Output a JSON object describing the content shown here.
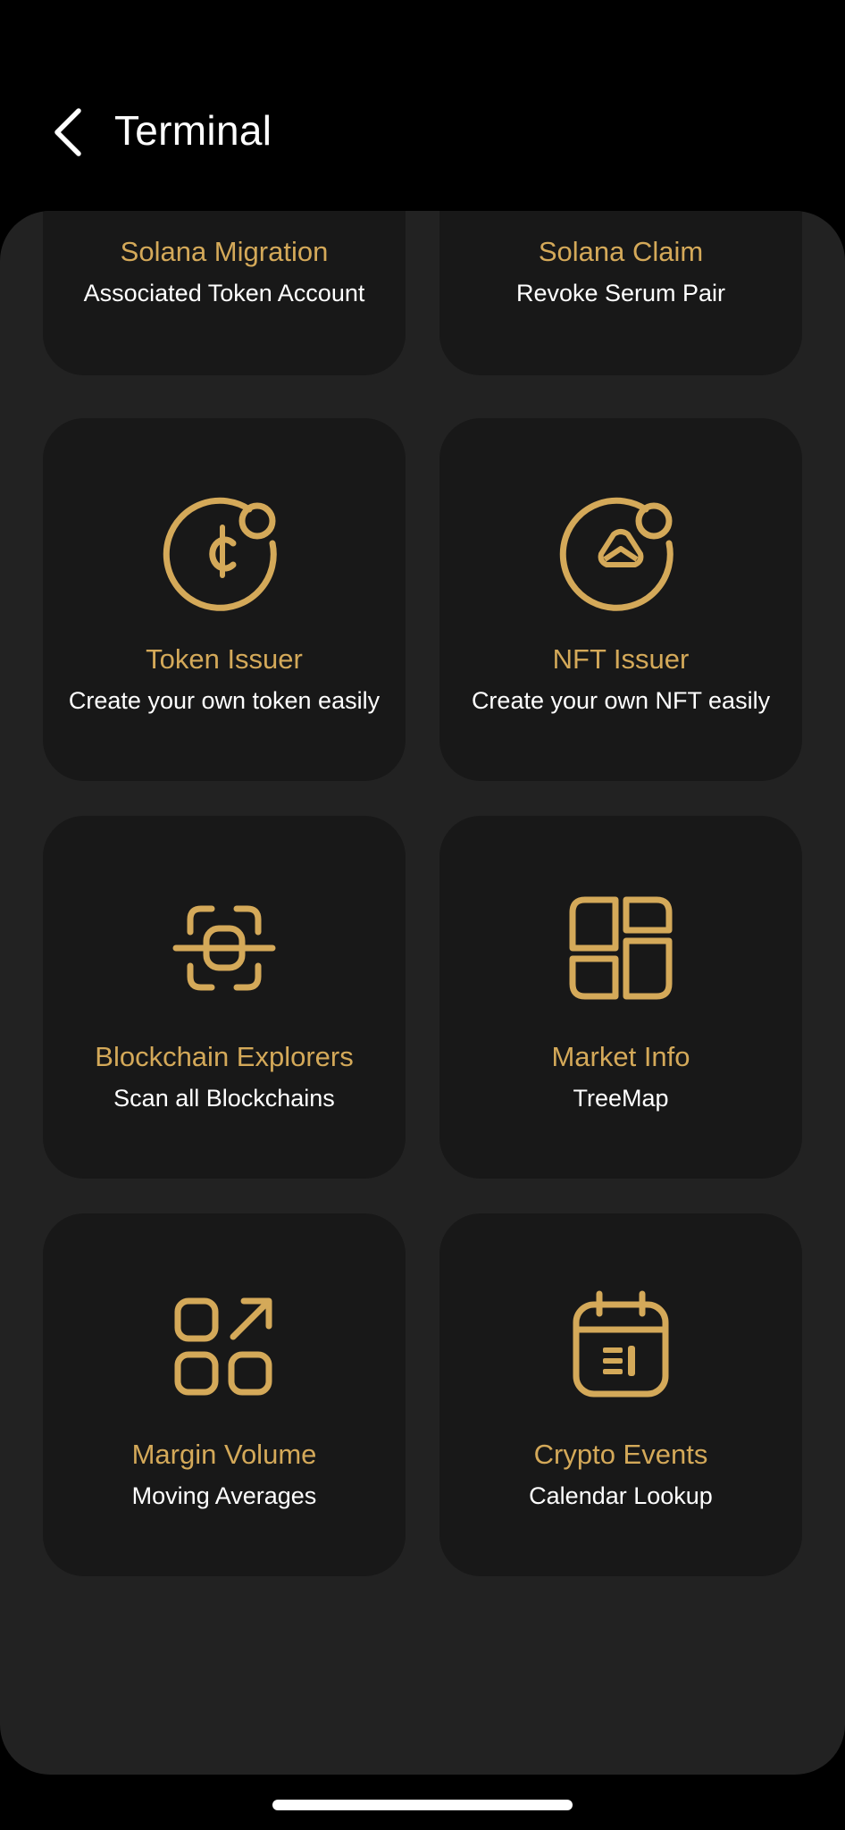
{
  "header": {
    "title": "Terminal",
    "back_icon": "chevron-left-icon"
  },
  "colors": {
    "background": "#000000",
    "panel": "#222222",
    "card": "#181818",
    "accent": "#d4a959",
    "text": "#ffffff"
  },
  "cards": [
    {
      "title": "Solana Migration",
      "subtitle": "Associated Token Account",
      "icon": null
    },
    {
      "title": "Solana Claim",
      "subtitle": "Revoke Serum Pair",
      "icon": null
    },
    {
      "title": "Token Issuer",
      "subtitle": "Create your own token easily",
      "icon": "coin-badge-icon"
    },
    {
      "title": "NFT Issuer",
      "subtitle": "Create your own NFT easily",
      "icon": "nft-badge-icon"
    },
    {
      "title": "Blockchain Explorers",
      "subtitle": "Scan all Blockchains",
      "icon": "scan-icon"
    },
    {
      "title": "Market Info",
      "subtitle": "TreeMap",
      "icon": "treemap-icon"
    },
    {
      "title": "Margin Volume",
      "subtitle": "Moving Averages",
      "icon": "grid-arrow-icon"
    },
    {
      "title": "Crypto Events",
      "subtitle": "Calendar Lookup",
      "icon": "calendar-icon"
    }
  ]
}
